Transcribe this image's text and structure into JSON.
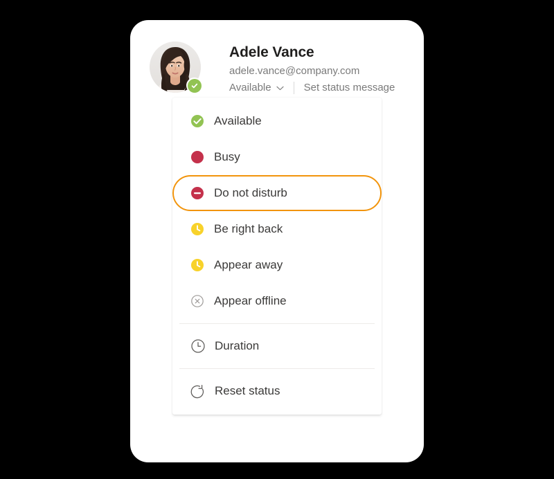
{
  "profile": {
    "name": "Adele Vance",
    "email": "adele.vance@company.com",
    "current_status": "Available",
    "set_status_label": "Set status message",
    "presence_color": "#92c353",
    "avatar_alt": "Adele Vance profile photo"
  },
  "menu": {
    "status_options": [
      {
        "label": "Available",
        "icon": "available-icon",
        "color": "#92c353",
        "focused": false
      },
      {
        "label": "Busy",
        "icon": "busy-icon",
        "color": "#c4314b",
        "focused": false
      },
      {
        "label": "Do not disturb",
        "icon": "do-not-disturb-icon",
        "color": "#c4314b",
        "focused": true
      },
      {
        "label": "Be right back",
        "icon": "be-right-back-icon",
        "color": "#f8d22a",
        "focused": false
      },
      {
        "label": "Appear away",
        "icon": "appear-away-icon",
        "color": "#f8d22a",
        "focused": false
      },
      {
        "label": "Appear offline",
        "icon": "appear-offline-icon",
        "color": "#8a8886",
        "focused": false
      }
    ],
    "duration": {
      "label": "Duration",
      "icon": "clock-outline-icon"
    },
    "reset": {
      "label": "Reset status",
      "icon": "reset-icon"
    }
  },
  "theme": {
    "focus_ring": "#f2940b",
    "text_primary": "#201f1e",
    "text_secondary": "#7a7a7a",
    "divider": "#edebe9",
    "background": "#000000",
    "card": "#ffffff"
  }
}
